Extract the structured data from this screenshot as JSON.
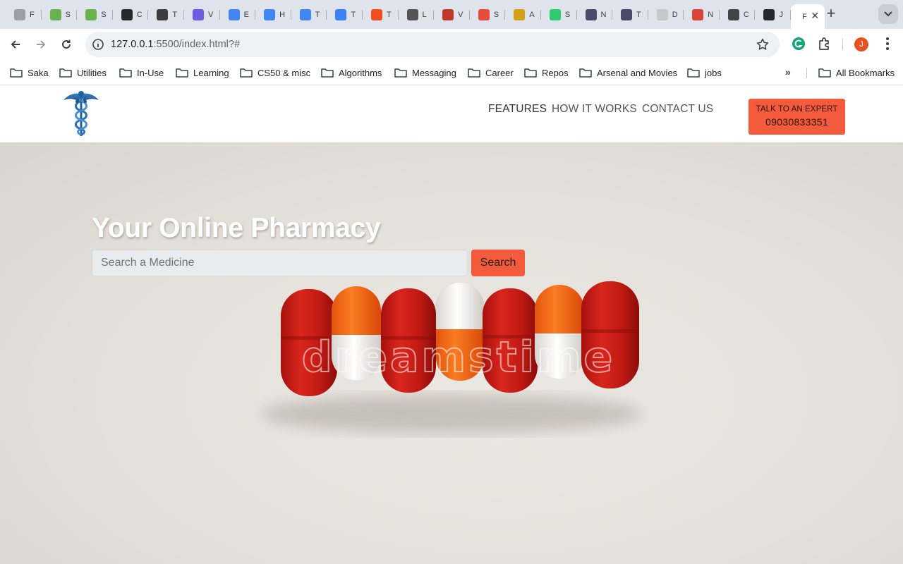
{
  "browser": {
    "tabs": [
      {
        "name": "tab-1",
        "title": "F",
        "icon": "circle-icon",
        "color": "#9aa0a6"
      },
      {
        "name": "tab-2",
        "title": "S",
        "icon": "h-circle-icon",
        "color": "#6ab04c"
      },
      {
        "name": "tab-3",
        "title": "S",
        "icon": "h-circle-icon",
        "color": "#6ab04c"
      },
      {
        "name": "tab-4",
        "title": "C",
        "icon": "github-icon",
        "color": "#24292f"
      },
      {
        "name": "tab-5",
        "title": "T",
        "icon": "triangle-icon",
        "color": "#3c3c3c"
      },
      {
        "name": "tab-6",
        "title": "V",
        "icon": "s-icon",
        "color": "#6e5ce6"
      },
      {
        "name": "tab-7",
        "title": "E",
        "icon": "docs-icon",
        "color": "#4285f4"
      },
      {
        "name": "tab-8",
        "title": "H",
        "icon": "docs-icon",
        "color": "#4285f4"
      },
      {
        "name": "tab-9",
        "title": "T",
        "icon": "docs-icon",
        "color": "#4285f4"
      },
      {
        "name": "tab-10",
        "title": "T",
        "icon": "diamond-icon",
        "color": "#3b82f6"
      },
      {
        "name": "tab-11",
        "title": "T",
        "icon": "figma-icon",
        "color": "#f24e1e"
      },
      {
        "name": "tab-12",
        "title": "L",
        "icon": "l-icon",
        "color": "#555555"
      },
      {
        "name": "tab-13",
        "title": "V",
        "icon": "s-flag-icon",
        "color": "#c0392b"
      },
      {
        "name": "tab-14",
        "title": "S",
        "icon": "s-circle-icon",
        "color": "#e74c3c"
      },
      {
        "name": "tab-15",
        "title": "A",
        "icon": "m-icon",
        "color": "#d4a017"
      },
      {
        "name": "tab-16",
        "title": "S",
        "icon": "s-icon",
        "color": "#2ecc71"
      },
      {
        "name": "tab-17",
        "title": "N",
        "icon": "s-icon",
        "color": "#4a4a6a"
      },
      {
        "name": "tab-18",
        "title": "T",
        "icon": "s-icon",
        "color": "#4a4a6a"
      },
      {
        "name": "tab-19",
        "title": "D",
        "icon": "card-icon",
        "color": "#c8c8c8"
      },
      {
        "name": "tab-20",
        "title": "N",
        "icon": "m-circle-icon",
        "color": "#db4437"
      },
      {
        "name": "tab-21",
        "title": "C",
        "icon": "bracket-icon",
        "color": "#444444"
      },
      {
        "name": "tab-22",
        "title": "J",
        "icon": "github-icon",
        "color": "#24292f"
      },
      {
        "name": "tab-active",
        "title": "F",
        "icon": "",
        "color": "#ffffff"
      }
    ],
    "url_host": "127.0.0.1",
    "url_rest": ":5500/index.html?#",
    "profile_initial": "J",
    "bookmarks": [
      "Saka",
      "Utilities",
      "In-Use",
      "Learning",
      "CS50 & misc",
      "Algorithms",
      "Messaging",
      "Career",
      "Repos",
      "Arsenal and Movies",
      "jobs"
    ],
    "all_bookmarks": "All Bookmarks"
  },
  "site": {
    "nav": [
      "FEATURES",
      "HOW IT WORKS",
      "CONTACT US"
    ],
    "cta_line1": "TALK TO AN EXPERT",
    "cta_line2": "09030833351",
    "hero_title": "Your Online Pharmacy",
    "search_placeholder": "Search a Medicine",
    "search_button": "Search",
    "watermark": "dreamstime",
    "accent": "#f45b3d"
  }
}
